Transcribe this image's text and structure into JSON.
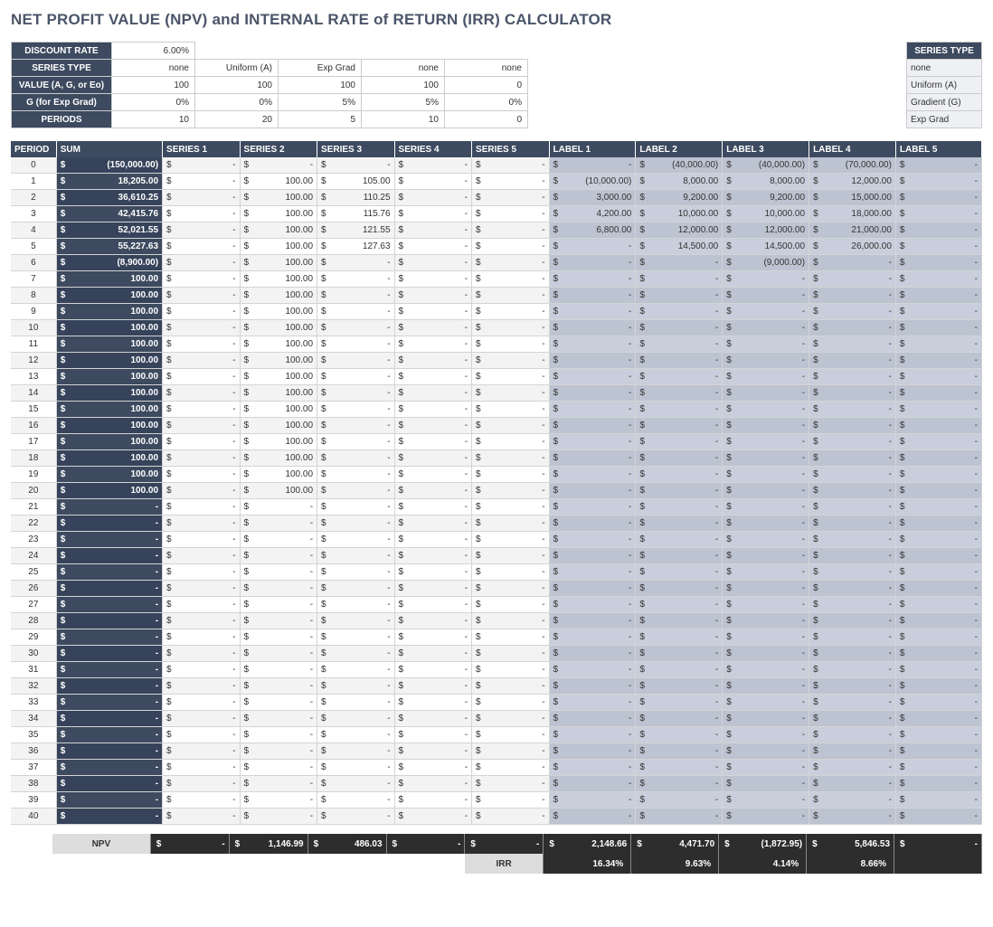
{
  "title": "NET PROFIT VALUE (NPV) and INTERNAL RATE of RETURN (IRR) CALCULATOR",
  "params": {
    "rows": [
      "DISCOUNT RATE",
      "SERIES TYPE",
      "VALUE (A, G, or Eo)",
      "G (for Exp Grad)",
      "PERIODS"
    ],
    "discount_rate": "6.00%",
    "series_type": [
      "none",
      "Uniform (A)",
      "Exp Grad",
      "none",
      "none"
    ],
    "value": [
      "100",
      "100",
      "100",
      "100",
      "0"
    ],
    "g": [
      "0%",
      "0%",
      "5%",
      "5%",
      "0%"
    ],
    "periods": [
      "10",
      "20",
      "5",
      "10",
      "0"
    ]
  },
  "series_type_legend": {
    "header": "SERIES TYPE",
    "items": [
      "none",
      "Uniform (A)",
      "Gradient (G)",
      "Exp Grad"
    ]
  },
  "columns": {
    "period": "PERIOD",
    "sum": "SUM",
    "series": [
      "SERIES 1",
      "SERIES 2",
      "SERIES 3",
      "SERIES 4",
      "SERIES 5"
    ],
    "labels": [
      "LABEL 1",
      "LABEL 2",
      "LABEL 3",
      "LABEL 4",
      "LABEL 5"
    ]
  },
  "rows": [
    {
      "p": 0,
      "sum": "(150,000.00)",
      "s": [
        "-",
        "-",
        "-",
        "-",
        "-"
      ],
      "l": [
        "-",
        "(40,000.00)",
        "(40,000.00)",
        "(70,000.00)",
        "-"
      ]
    },
    {
      "p": 1,
      "sum": "18,205.00",
      "s": [
        "-",
        "100.00",
        "105.00",
        "-",
        "-"
      ],
      "l": [
        "(10,000.00)",
        "8,000.00",
        "8,000.00",
        "12,000.00",
        "-"
      ]
    },
    {
      "p": 2,
      "sum": "36,610.25",
      "s": [
        "-",
        "100.00",
        "110.25",
        "-",
        "-"
      ],
      "l": [
        "3,000.00",
        "9,200.00",
        "9,200.00",
        "15,000.00",
        "-"
      ]
    },
    {
      "p": 3,
      "sum": "42,415.76",
      "s": [
        "-",
        "100.00",
        "115.76",
        "-",
        "-"
      ],
      "l": [
        "4,200.00",
        "10,000.00",
        "10,000.00",
        "18,000.00",
        "-"
      ]
    },
    {
      "p": 4,
      "sum": "52,021.55",
      "s": [
        "-",
        "100.00",
        "121.55",
        "-",
        "-"
      ],
      "l": [
        "6,800.00",
        "12,000.00",
        "12,000.00",
        "21,000.00",
        "-"
      ]
    },
    {
      "p": 5,
      "sum": "55,227.63",
      "s": [
        "-",
        "100.00",
        "127.63",
        "-",
        "-"
      ],
      "l": [
        "-",
        "14,500.00",
        "14,500.00",
        "26,000.00",
        "-"
      ]
    },
    {
      "p": 6,
      "sum": "(8,900.00)",
      "s": [
        "-",
        "100.00",
        "-",
        "-",
        "-"
      ],
      "l": [
        "-",
        "-",
        "(9,000.00)",
        "-",
        "-"
      ]
    },
    {
      "p": 7,
      "sum": "100.00",
      "s": [
        "-",
        "100.00",
        "-",
        "-",
        "-"
      ],
      "l": [
        "-",
        "-",
        "-",
        "-",
        "-"
      ]
    },
    {
      "p": 8,
      "sum": "100.00",
      "s": [
        "-",
        "100.00",
        "-",
        "-",
        "-"
      ],
      "l": [
        "-",
        "-",
        "-",
        "-",
        "-"
      ]
    },
    {
      "p": 9,
      "sum": "100.00",
      "s": [
        "-",
        "100.00",
        "-",
        "-",
        "-"
      ],
      "l": [
        "-",
        "-",
        "-",
        "-",
        "-"
      ]
    },
    {
      "p": 10,
      "sum": "100.00",
      "s": [
        "-",
        "100.00",
        "-",
        "-",
        "-"
      ],
      "l": [
        "-",
        "-",
        "-",
        "-",
        "-"
      ]
    },
    {
      "p": 11,
      "sum": "100.00",
      "s": [
        "-",
        "100.00",
        "-",
        "-",
        "-"
      ],
      "l": [
        "-",
        "-",
        "-",
        "-",
        "-"
      ]
    },
    {
      "p": 12,
      "sum": "100.00",
      "s": [
        "-",
        "100.00",
        "-",
        "-",
        "-"
      ],
      "l": [
        "-",
        "-",
        "-",
        "-",
        "-"
      ]
    },
    {
      "p": 13,
      "sum": "100.00",
      "s": [
        "-",
        "100.00",
        "-",
        "-",
        "-"
      ],
      "l": [
        "-",
        "-",
        "-",
        "-",
        "-"
      ]
    },
    {
      "p": 14,
      "sum": "100.00",
      "s": [
        "-",
        "100.00",
        "-",
        "-",
        "-"
      ],
      "l": [
        "-",
        "-",
        "-",
        "-",
        "-"
      ]
    },
    {
      "p": 15,
      "sum": "100.00",
      "s": [
        "-",
        "100.00",
        "-",
        "-",
        "-"
      ],
      "l": [
        "-",
        "-",
        "-",
        "-",
        "-"
      ]
    },
    {
      "p": 16,
      "sum": "100.00",
      "s": [
        "-",
        "100.00",
        "-",
        "-",
        "-"
      ],
      "l": [
        "-",
        "-",
        "-",
        "-",
        "-"
      ]
    },
    {
      "p": 17,
      "sum": "100.00",
      "s": [
        "-",
        "100.00",
        "-",
        "-",
        "-"
      ],
      "l": [
        "-",
        "-",
        "-",
        "-",
        "-"
      ]
    },
    {
      "p": 18,
      "sum": "100.00",
      "s": [
        "-",
        "100.00",
        "-",
        "-",
        "-"
      ],
      "l": [
        "-",
        "-",
        "-",
        "-",
        "-"
      ]
    },
    {
      "p": 19,
      "sum": "100.00",
      "s": [
        "-",
        "100.00",
        "-",
        "-",
        "-"
      ],
      "l": [
        "-",
        "-",
        "-",
        "-",
        "-"
      ]
    },
    {
      "p": 20,
      "sum": "100.00",
      "s": [
        "-",
        "100.00",
        "-",
        "-",
        "-"
      ],
      "l": [
        "-",
        "-",
        "-",
        "-",
        "-"
      ]
    },
    {
      "p": 21,
      "sum": "-",
      "s": [
        "-",
        "-",
        "-",
        "-",
        "-"
      ],
      "l": [
        "-",
        "-",
        "-",
        "-",
        "-"
      ]
    },
    {
      "p": 22,
      "sum": "-",
      "s": [
        "-",
        "-",
        "-",
        "-",
        "-"
      ],
      "l": [
        "-",
        "-",
        "-",
        "-",
        "-"
      ]
    },
    {
      "p": 23,
      "sum": "-",
      "s": [
        "-",
        "-",
        "-",
        "-",
        "-"
      ],
      "l": [
        "-",
        "-",
        "-",
        "-",
        "-"
      ]
    },
    {
      "p": 24,
      "sum": "-",
      "s": [
        "-",
        "-",
        "-",
        "-",
        "-"
      ],
      "l": [
        "-",
        "-",
        "-",
        "-",
        "-"
      ]
    },
    {
      "p": 25,
      "sum": "-",
      "s": [
        "-",
        "-",
        "-",
        "-",
        "-"
      ],
      "l": [
        "-",
        "-",
        "-",
        "-",
        "-"
      ]
    },
    {
      "p": 26,
      "sum": "-",
      "s": [
        "-",
        "-",
        "-",
        "-",
        "-"
      ],
      "l": [
        "-",
        "-",
        "-",
        "-",
        "-"
      ]
    },
    {
      "p": 27,
      "sum": "-",
      "s": [
        "-",
        "-",
        "-",
        "-",
        "-"
      ],
      "l": [
        "-",
        "-",
        "-",
        "-",
        "-"
      ]
    },
    {
      "p": 28,
      "sum": "-",
      "s": [
        "-",
        "-",
        "-",
        "-",
        "-"
      ],
      "l": [
        "-",
        "-",
        "-",
        "-",
        "-"
      ]
    },
    {
      "p": 29,
      "sum": "-",
      "s": [
        "-",
        "-",
        "-",
        "-",
        "-"
      ],
      "l": [
        "-",
        "-",
        "-",
        "-",
        "-"
      ]
    },
    {
      "p": 30,
      "sum": "-",
      "s": [
        "-",
        "-",
        "-",
        "-",
        "-"
      ],
      "l": [
        "-",
        "-",
        "-",
        "-",
        "-"
      ]
    },
    {
      "p": 31,
      "sum": "-",
      "s": [
        "-",
        "-",
        "-",
        "-",
        "-"
      ],
      "l": [
        "-",
        "-",
        "-",
        "-",
        "-"
      ]
    },
    {
      "p": 32,
      "sum": "-",
      "s": [
        "-",
        "-",
        "-",
        "-",
        "-"
      ],
      "l": [
        "-",
        "-",
        "-",
        "-",
        "-"
      ]
    },
    {
      "p": 33,
      "sum": "-",
      "s": [
        "-",
        "-",
        "-",
        "-",
        "-"
      ],
      "l": [
        "-",
        "-",
        "-",
        "-",
        "-"
      ]
    },
    {
      "p": 34,
      "sum": "-",
      "s": [
        "-",
        "-",
        "-",
        "-",
        "-"
      ],
      "l": [
        "-",
        "-",
        "-",
        "-",
        "-"
      ]
    },
    {
      "p": 35,
      "sum": "-",
      "s": [
        "-",
        "-",
        "-",
        "-",
        "-"
      ],
      "l": [
        "-",
        "-",
        "-",
        "-",
        "-"
      ]
    },
    {
      "p": 36,
      "sum": "-",
      "s": [
        "-",
        "-",
        "-",
        "-",
        "-"
      ],
      "l": [
        "-",
        "-",
        "-",
        "-",
        "-"
      ]
    },
    {
      "p": 37,
      "sum": "-",
      "s": [
        "-",
        "-",
        "-",
        "-",
        "-"
      ],
      "l": [
        "-",
        "-",
        "-",
        "-",
        "-"
      ]
    },
    {
      "p": 38,
      "sum": "-",
      "s": [
        "-",
        "-",
        "-",
        "-",
        "-"
      ],
      "l": [
        "-",
        "-",
        "-",
        "-",
        "-"
      ]
    },
    {
      "p": 39,
      "sum": "-",
      "s": [
        "-",
        "-",
        "-",
        "-",
        "-"
      ],
      "l": [
        "-",
        "-",
        "-",
        "-",
        "-"
      ]
    },
    {
      "p": 40,
      "sum": "-",
      "s": [
        "-",
        "-",
        "-",
        "-",
        "-"
      ],
      "l": [
        "-",
        "-",
        "-",
        "-",
        "-"
      ]
    }
  ],
  "footer": {
    "npv_label": "NPV",
    "npv": [
      "-",
      "1,146.99",
      "486.03",
      "-",
      "-",
      "2,148.66",
      "4,471.70",
      "(1,872.95)",
      "5,846.53",
      "-"
    ],
    "irr_label": "IRR",
    "irr": [
      "16.34%",
      "9.63%",
      "4.14%",
      "8.66%",
      ""
    ]
  }
}
